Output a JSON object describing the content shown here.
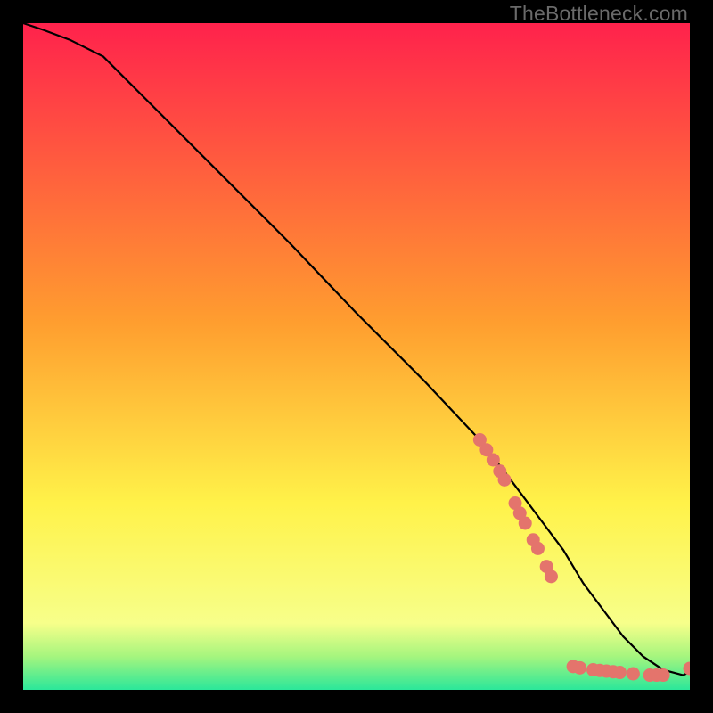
{
  "watermark": "TheBottleneck.com",
  "chart_data": {
    "type": "line",
    "title": "",
    "xlabel": "",
    "ylabel": "",
    "xlim": [
      0,
      100
    ],
    "ylim": [
      0,
      100
    ],
    "grid": false,
    "legend": false,
    "background_gradient": {
      "top": "#ff224c",
      "mid1": "#ff9e2f",
      "mid2": "#fff249",
      "greenish": "#a5f57e",
      "bottom": "#2be79a"
    },
    "series": [
      {
        "name": "bottleneck-curve",
        "color": "#000000",
        "x": [
          0,
          3,
          7,
          12,
          20,
          30,
          40,
          50,
          60,
          68,
          72,
          75,
          78,
          81,
          84,
          87,
          90,
          93,
          96,
          99,
          100
        ],
        "y": [
          100,
          99,
          97.5,
          95,
          87,
          77,
          67,
          56.5,
          46.5,
          38,
          33,
          29,
          25,
          21,
          16,
          12,
          8,
          5,
          3,
          2.2,
          2.7
        ]
      }
    ],
    "points": [
      {
        "name": "sample-point",
        "color": "#e4746c",
        "x": 68.5,
        "y": 37.5
      },
      {
        "name": "sample-point",
        "color": "#e4746c",
        "x": 69.5,
        "y": 36
      },
      {
        "name": "sample-point",
        "color": "#e4746c",
        "x": 70.5,
        "y": 34.5
      },
      {
        "name": "sample-point",
        "color": "#e4746c",
        "x": 71.5,
        "y": 32.8
      },
      {
        "name": "sample-point",
        "color": "#e4746c",
        "x": 72.2,
        "y": 31.5
      },
      {
        "name": "sample-point",
        "color": "#e4746c",
        "x": 73.8,
        "y": 28
      },
      {
        "name": "sample-point",
        "color": "#e4746c",
        "x": 74.5,
        "y": 26.5
      },
      {
        "name": "sample-point",
        "color": "#e4746c",
        "x": 75.3,
        "y": 25
      },
      {
        "name": "sample-point",
        "color": "#e4746c",
        "x": 76.5,
        "y": 22.5
      },
      {
        "name": "sample-point",
        "color": "#e4746c",
        "x": 77.2,
        "y": 21.2
      },
      {
        "name": "sample-point",
        "color": "#e4746c",
        "x": 78.5,
        "y": 18.5
      },
      {
        "name": "sample-point",
        "color": "#e4746c",
        "x": 79.2,
        "y": 17
      },
      {
        "name": "sample-point",
        "color": "#e4746c",
        "x": 82.5,
        "y": 3.5
      },
      {
        "name": "sample-point",
        "color": "#e4746c",
        "x": 83.5,
        "y": 3.3
      },
      {
        "name": "sample-point",
        "color": "#e4746c",
        "x": 85.5,
        "y": 3
      },
      {
        "name": "sample-point",
        "color": "#e4746c",
        "x": 86.5,
        "y": 2.9
      },
      {
        "name": "sample-point",
        "color": "#e4746c",
        "x": 87.5,
        "y": 2.8
      },
      {
        "name": "sample-point",
        "color": "#e4746c",
        "x": 88.5,
        "y": 2.7
      },
      {
        "name": "sample-point",
        "color": "#e4746c",
        "x": 89.5,
        "y": 2.6
      },
      {
        "name": "sample-point",
        "color": "#e4746c",
        "x": 91.5,
        "y": 2.4
      },
      {
        "name": "sample-point",
        "color": "#e4746c",
        "x": 94,
        "y": 2.2
      },
      {
        "name": "sample-point",
        "color": "#e4746c",
        "x": 95,
        "y": 2.2
      },
      {
        "name": "sample-point",
        "color": "#e4746c",
        "x": 96,
        "y": 2.2
      },
      {
        "name": "sample-point",
        "color": "#e4746c",
        "x": 100,
        "y": 3.2
      }
    ]
  }
}
